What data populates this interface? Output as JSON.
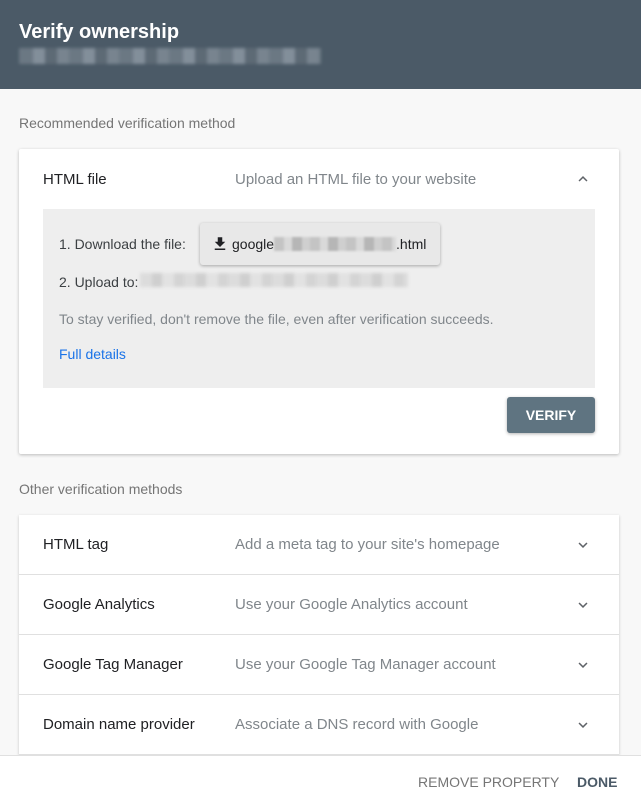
{
  "header": {
    "title": "Verify ownership"
  },
  "recommended": {
    "section_label": "Recommended verification method",
    "title": "HTML file",
    "description": "Upload an HTML file to your website",
    "step1_label": "1. Download the file:",
    "file_prefix": "google",
    "file_suffix": ".html",
    "step2_label": "2. Upload to:",
    "note": "To stay verified, don't remove the file, even after verification succeeds.",
    "link": "Full details",
    "verify_label": "VERIFY"
  },
  "other": {
    "section_label": "Other verification methods",
    "methods": [
      {
        "title": "HTML tag",
        "description": "Add a meta tag to your site's homepage"
      },
      {
        "title": "Google Analytics",
        "description": "Use your Google Analytics account"
      },
      {
        "title": "Google Tag Manager",
        "description": "Use your Google Tag Manager account"
      },
      {
        "title": "Domain name provider",
        "description": "Associate a DNS record with Google"
      }
    ]
  },
  "footer": {
    "remove_label": "REMOVE PROPERTY",
    "done_label": "DONE"
  },
  "colors": {
    "header_bg": "#4b5a67",
    "verify_bg": "#5f7481",
    "link": "#1a73e8"
  },
  "icons": {
    "collapse": "chevron-up-icon",
    "expand": "chevron-down-icon",
    "download": "download-icon"
  }
}
